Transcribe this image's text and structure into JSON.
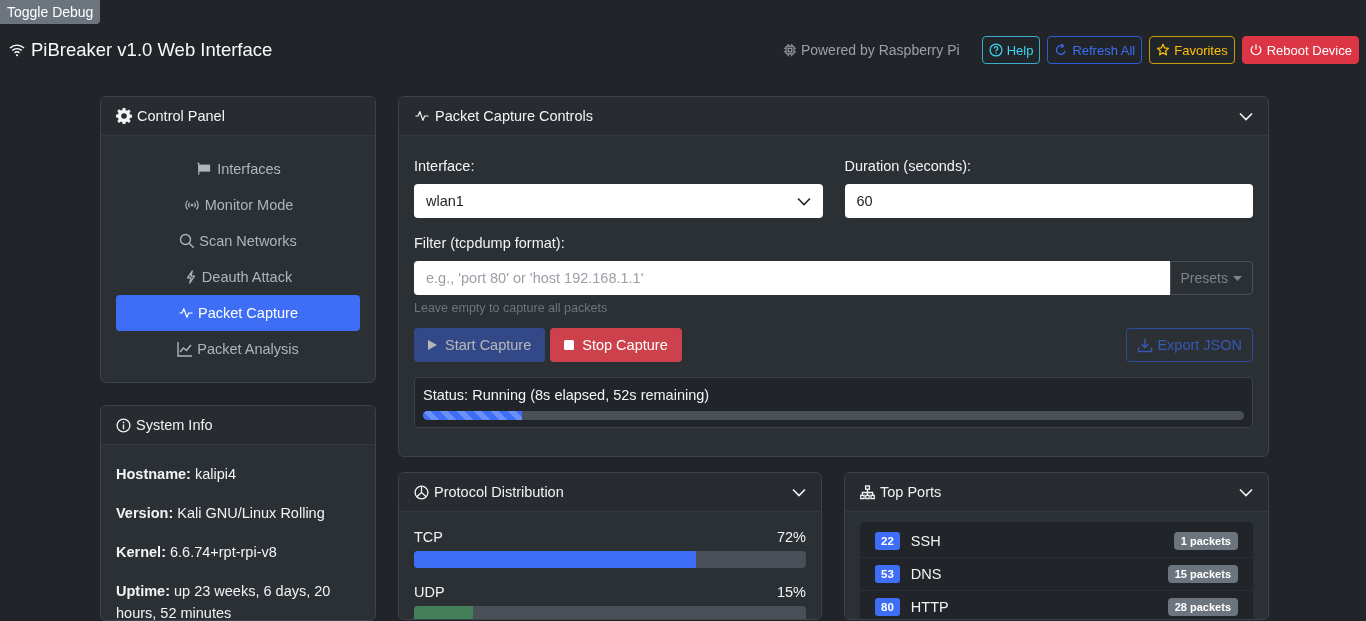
{
  "debug_button": "Toggle Debug",
  "header": {
    "title": "PiBreaker v1.0 Web Interface",
    "powered_by": "Powered by Raspberry Pi",
    "buttons": [
      {
        "label": "Help",
        "kind": "help"
      },
      {
        "label": "Refresh All",
        "kind": "refresh"
      },
      {
        "label": "Favorites",
        "kind": "favorites"
      },
      {
        "label": "Reboot Device",
        "kind": "reboot"
      }
    ]
  },
  "sidebar": {
    "title": "Control Panel",
    "items": [
      {
        "label": "Interfaces",
        "selected": false
      },
      {
        "label": "Monitor Mode",
        "selected": false
      },
      {
        "label": "Scan Networks",
        "selected": false
      },
      {
        "label": "Deauth Attack",
        "selected": false
      },
      {
        "label": "Packet Capture",
        "selected": true
      },
      {
        "label": "Packet Analysis",
        "selected": false
      }
    ]
  },
  "system_info": {
    "title": "System Info",
    "fields": [
      {
        "label": "Hostname:",
        "value": "kalipi4"
      },
      {
        "label": "Version:",
        "value": "Kali GNU/Linux Rolling"
      },
      {
        "label": "Kernel:",
        "value": "6.6.74+rpt-rpi-v8"
      },
      {
        "label": "Uptime:",
        "value": "up 23 weeks, 6 days, 20 hours, 52 minutes"
      }
    ]
  },
  "capture": {
    "title": "Packet Capture Controls",
    "interface": {
      "label": "Interface:",
      "value": "wlan1"
    },
    "duration": {
      "label": "Duration (seconds):",
      "value": "60"
    },
    "filter": {
      "label": "Filter (tcpdump format):",
      "placeholder": "e.g., 'port 80' or 'host 192.168.1.1'",
      "presets": "Presets",
      "help": "Leave empty to capture all packets"
    },
    "buttons": [
      {
        "label": "Start Capture",
        "kind": "start",
        "disabled": true
      },
      {
        "label": "Stop Capture",
        "kind": "stop",
        "disabled": false
      },
      {
        "label": "Export JSON",
        "kind": "export",
        "disabled": true
      }
    ],
    "status": {
      "text": "Status: Running (8s elapsed, 52s remaining)",
      "level": 0.12
    }
  },
  "protocols": {
    "title": "Protocol Distribution",
    "items": [
      {
        "name": "TCP",
        "percent": "72%",
        "level": 0.72,
        "color": "#3d6ef5"
      },
      {
        "name": "UDP",
        "percent": "15%",
        "level": 0.15,
        "color": "#43805a"
      }
    ]
  },
  "ports": {
    "title": "Top Ports",
    "items": [
      {
        "port": "22",
        "name": "SSH",
        "count": "1 packets"
      },
      {
        "port": "53",
        "name": "DNS",
        "count": "15 packets"
      },
      {
        "port": "80",
        "name": "HTTP",
        "count": "28 packets"
      }
    ]
  }
}
